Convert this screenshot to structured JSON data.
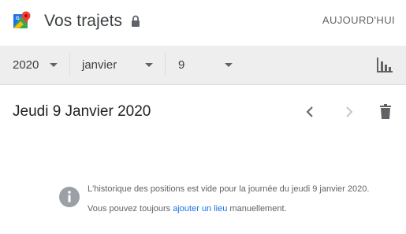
{
  "header": {
    "title": "Vos trajets",
    "today_label": "AUJOURD'HUI"
  },
  "filters": {
    "year": "2020",
    "month": "janvier",
    "day": "9"
  },
  "day_view": {
    "date_title": "Jeudi 9 Janvier 2020"
  },
  "empty_state": {
    "message": "L'historique des positions est vide pour la journée du jeudi 9 janvier 2020.",
    "hint_prefix": "Vous pouvez toujours",
    "hint_link": "ajouter un lieu",
    "hint_suffix": "manuellement."
  },
  "icons": {
    "app": "google-maps-logo",
    "privacy": "lock-icon",
    "stats": "bar-chart-icon",
    "prev": "chevron-left-icon",
    "next": "chevron-right-icon",
    "delete": "trash-icon",
    "info": "info-icon"
  },
  "colors": {
    "link": "#1a73e8",
    "toolbar_bg": "#eeeeee",
    "icon": "#5f6368"
  }
}
